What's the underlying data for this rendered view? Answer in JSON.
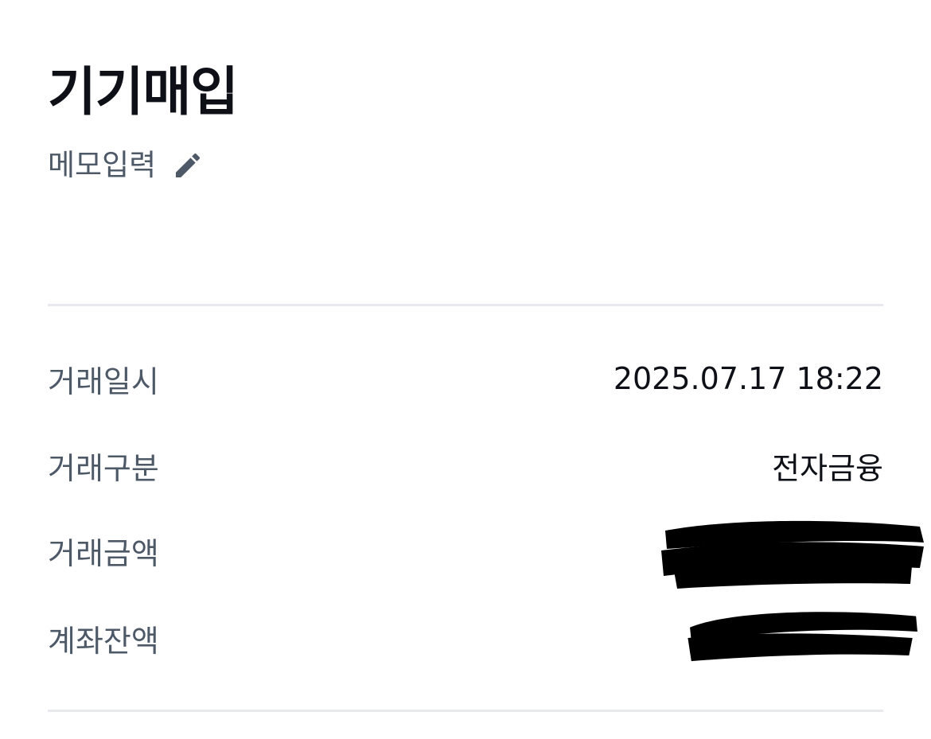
{
  "header": {
    "title": "기기매입",
    "memo_label": "메모입력",
    "memo_icon": "pencil-icon"
  },
  "details": {
    "rows": [
      {
        "label": "거래일시",
        "value": "2025.07.17 18:22"
      },
      {
        "label": "거래구분",
        "value": "전자금융"
      },
      {
        "label": "거래금액",
        "value": ""
      },
      {
        "label": "계좌잔액",
        "value": ""
      }
    ]
  },
  "colors": {
    "text_primary": "#0d1117",
    "text_secondary": "#4e5968",
    "divider": "#e8e9ee",
    "redaction": "#000000"
  }
}
